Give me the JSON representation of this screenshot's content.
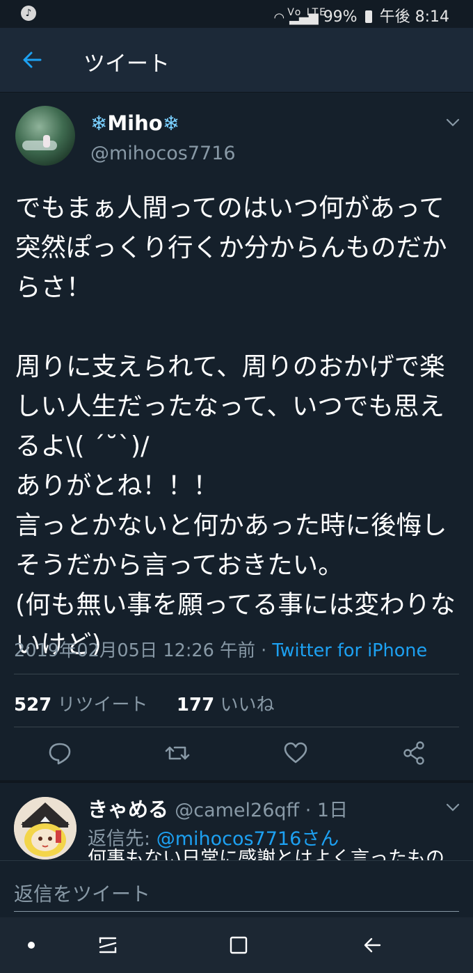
{
  "status_bar": {
    "left_icon": "music-note-icon",
    "indicators": "Vo LTE",
    "battery": "99%",
    "time": "午後 8:14"
  },
  "header": {
    "title": "ツイート",
    "back_icon": "back-arrow-icon"
  },
  "tweet": {
    "snowflake": "❄",
    "display_name": "Miho",
    "handle": "@mihocos7716",
    "text": "でもまぁ人間ってのはいつ何があって突然ぽっくり行くか分からんものだからさ！\n\n周りに支えられて、周りのおかげで楽しい人生だったなって、いつでも思えるよ\\( ´˘`)/\nありがとね！！！\n言っとかないと何かあった時に後悔しそうだから言っておきたい。\n(何も無い事を願ってる事には変わりないけど)",
    "timestamp": "2019年02月05日 12:26 午前",
    "separator": " · ",
    "source": "Twitter for iPhone",
    "retweet_count": "527",
    "retweet_label": "リツイート",
    "like_count": "177",
    "like_label": "いいね"
  },
  "actions": [
    "reply-icon",
    "retweet-icon",
    "like-icon",
    "share-icon"
  ],
  "reply": {
    "name": "きゃめる",
    "handle": "@camel26qff",
    "separator": " · ",
    "time": "1日",
    "reply_to_label": "返信先: ",
    "reply_to_mention": "@mihocos7716さん",
    "preview": "何事もない日常に感謝とはよく言ったもの"
  },
  "compose": {
    "placeholder": "返信をツイート"
  },
  "colors": {
    "background": "#15202b",
    "accent": "#1da1f2",
    "secondary_text": "#8899a6"
  }
}
